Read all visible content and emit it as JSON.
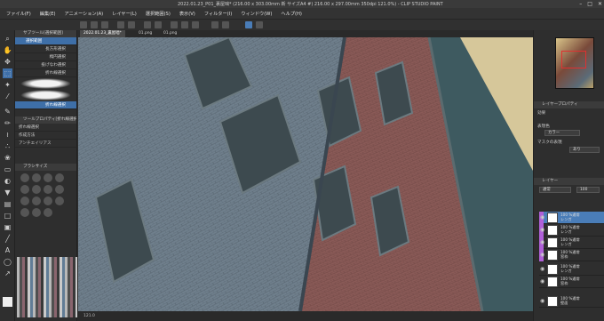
{
  "window": {
    "title": "2022.01.23_P01_裏屋咄* (216.00 x 303.00mm 新 サイズA4 #) 216.00 x 297.00mm 350dpi 121.0%) - CLIP STUDIO PAINT PRO"
  },
  "menu": [
    "ファイル(F)",
    "編集(E)",
    "アニメーション(A)",
    "レイヤー(L)",
    "選択範囲(S)",
    "表示(V)",
    "フィルター(I)",
    "ウィンドウ(W)",
    "ヘルプ(H)"
  ],
  "tabs": [
    "2022.01.23_裏屋咄*",
    "01.png",
    "01.png"
  ],
  "subtool": {
    "panel_title": "サブツール[選択範囲]",
    "group_label": "選択範囲",
    "items": [
      "長方形選択",
      "楕円選択",
      "投げなわ選択",
      "折れ線選択",
      "選択ペン",
      "選択消し",
      "",
      "折れ線選択"
    ],
    "tool_prop_title": "ツールプロパティ[折れ線選択]",
    "tool_prop_row": "折れ線選択",
    "prop_labels": [
      "作成方法",
      "アンチエイリアス"
    ],
    "brush_size_title": "ブラシサイズ"
  },
  "status": {
    "zoom": "121.0"
  },
  "right": {
    "layer_property": "レイヤープロパティ",
    "effect_label": "効果",
    "expression_color": "表現色",
    "color_value": "カラー",
    "mask_expression": "マスクの表現",
    "mask_value": "あり",
    "layer_panel": "レイヤー",
    "blend_mode": "通常",
    "opacity": "100",
    "layers": [
      {
        "name": "100 %通常\nレンガ",
        "color": "#b060d8"
      },
      {
        "name": "100 %通常\nレンガ",
        "color": "#b060d8"
      },
      {
        "name": "100 %通常\nレンガ",
        "color": "#b060d8"
      },
      {
        "name": "100 %通常\n窓枠",
        "color": "#b060d8"
      },
      {
        "name": "100 %通常\nレンガ",
        "color": "#2e2e2e"
      },
      {
        "name": "100 %通常\n窓枠",
        "color": "#2e2e2e"
      },
      {
        "name": "100 %通常\n壁面",
        "color": "#2e2e2e"
      }
    ]
  },
  "colors": {
    "accent": "#4a7db8",
    "layer_tag": "#b060d8"
  },
  "icons": [
    "selection-tool-icon",
    "pen-icon",
    "eraser-icon",
    "fill-icon",
    "text-icon",
    "eyedropper-icon",
    "hand-icon",
    "zoom-icon"
  ]
}
